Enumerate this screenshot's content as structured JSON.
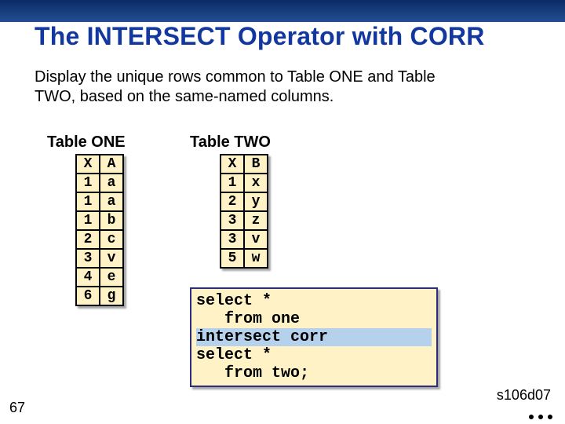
{
  "title": "The INTERSECT Operator with CORR",
  "subtitle": "Display the unique rows common to Table ONE and Table TWO, based on the same-named columns.",
  "tables": {
    "one": {
      "caption": "Table ONE",
      "header": [
        "X",
        "A"
      ],
      "rows": [
        [
          "1",
          "a"
        ],
        [
          "1",
          "a"
        ],
        [
          "1",
          "b"
        ],
        [
          "2",
          "c"
        ],
        [
          "3",
          "v"
        ],
        [
          "4",
          "e"
        ],
        [
          "6",
          "g"
        ]
      ]
    },
    "two": {
      "caption": "Table TWO",
      "header": [
        "X",
        "B"
      ],
      "rows": [
        [
          "1",
          "x"
        ],
        [
          "2",
          "y"
        ],
        [
          "3",
          "z"
        ],
        [
          "3",
          "v"
        ],
        [
          "5",
          "w"
        ]
      ]
    }
  },
  "code": {
    "lines": [
      {
        "text": "select *",
        "highlight": false
      },
      {
        "text": "   from one",
        "highlight": false
      },
      {
        "text": "intersect corr",
        "highlight": true
      },
      {
        "text": "select *",
        "highlight": false
      },
      {
        "text": "   from two;",
        "highlight": false
      }
    ]
  },
  "slide_number": "67",
  "ref": "s106d07"
}
